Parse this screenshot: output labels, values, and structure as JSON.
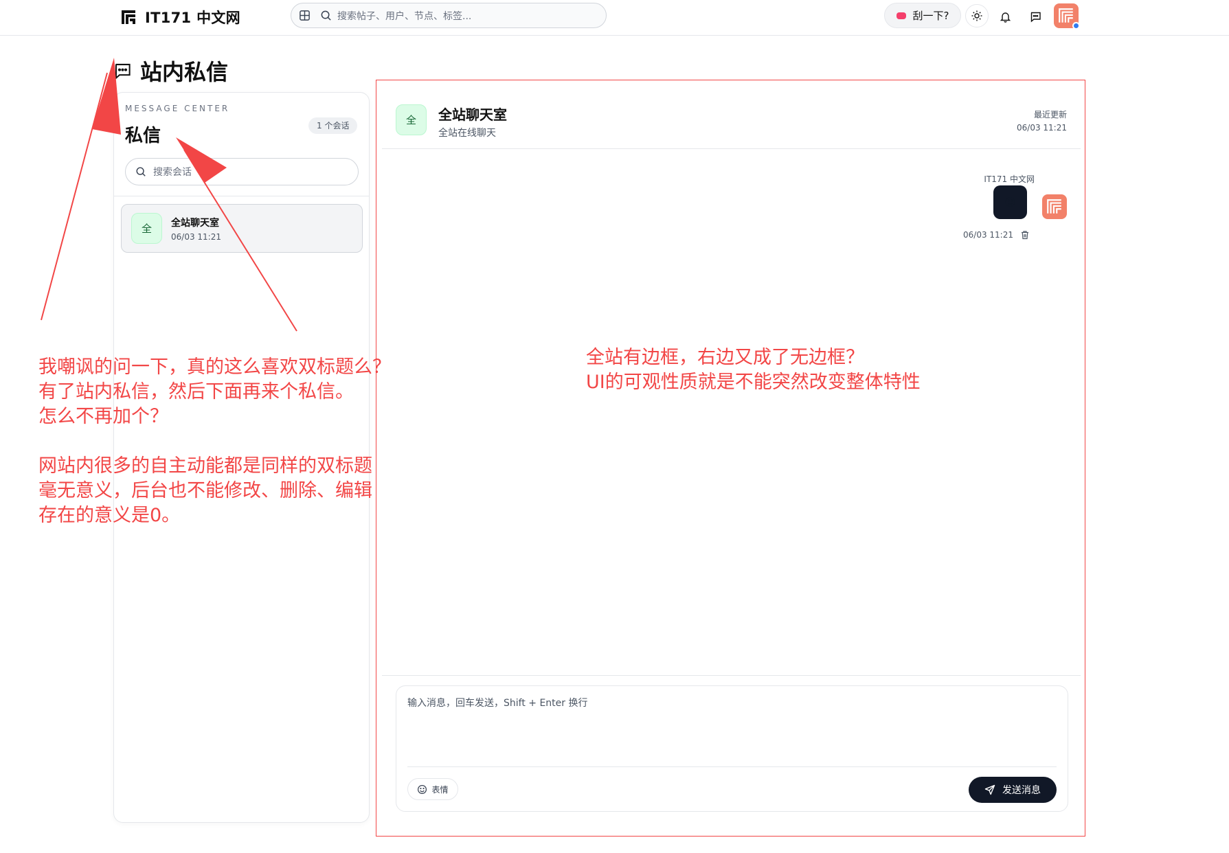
{
  "header": {
    "site_name": "IT171 中文网",
    "search_placeholder": "搜索帖子、用户、节点、标签...",
    "scratch_label": "刮一下?"
  },
  "page": {
    "title": "站内私信"
  },
  "sidebar": {
    "eyebrow": "MESSAGE CENTER",
    "title": "私信",
    "count_badge": "1 个会话",
    "search_placeholder": "搜索会话",
    "conversations": [
      {
        "avatar_text": "全",
        "name": "全站聊天室",
        "time": "06/03 11:21"
      }
    ]
  },
  "chat": {
    "avatar_text": "全",
    "title": "全站聊天室",
    "subtitle": "全站在线聊天",
    "updated_label": "最近更新",
    "updated_time": "06/03 11:21",
    "messages": [
      {
        "sender": "IT171 中文网",
        "content": "😜",
        "time": "06/03 11:21"
      }
    ],
    "composer_placeholder": "输入消息，回车发送，Shift + Enter 换行",
    "emoji_label": "表情",
    "send_label": "发送消息"
  },
  "annotations": {
    "left": "我嘲讽的问一下，真的这么喜欢双标题么？\n有了站内私信，然后下面再来个私信。\n怎么不再加个？\n\n网站内很多的自主动能都是同样的双标题\n毫无意义，后台也不能修改、删除、编辑\n存在的意义是0。",
    "right": "全站有边框，右边又成了无边框？\nUI的可观性质就是不能突然改变整体特性"
  },
  "colors": {
    "annotation_red": "#f24646",
    "brand_orange": "#f28169",
    "dark_button": "#111827",
    "group_avatar_green": "#dcfce7"
  },
  "icons": {
    "logo": "site-logo-icon",
    "grid": "grid-icon",
    "search": "search-icon",
    "ticket": "ticket-icon",
    "theme": "sun-icon",
    "notifications": "bell-icon",
    "messages": "chat-bubble-icon",
    "delete": "trash-icon",
    "emoji": "smiley-icon",
    "send": "send-icon"
  }
}
